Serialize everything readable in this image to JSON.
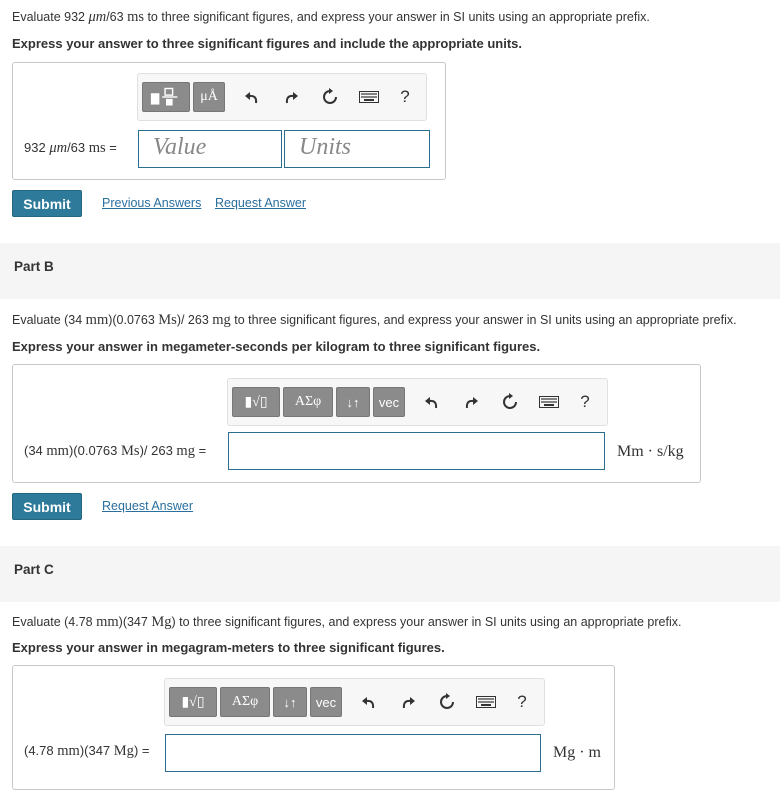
{
  "partA": {
    "prompt": {
      "pre": "Evaluate 932 ",
      "unit_um": "μm",
      "mid": "/63 ",
      "unit_ms": "ms",
      "post": " to three significant figures, and express your answer in SI units using an appropriate prefix."
    },
    "instruction": "Express your answer to three significant figures and include the appropriate units.",
    "toolbar": {
      "unit_button_label": "μÅ",
      "help_label": "?"
    },
    "label": {
      "pre": "932 ",
      "unit_um": "μm",
      "mid": "/63 ",
      "unit_ms": "ms",
      "post": " ="
    },
    "value_placeholder": "Value",
    "units_placeholder": "Units",
    "submit_label": "Submit",
    "previous_answers_label": "Previous Answers",
    "request_answer_label": "Request Answer"
  },
  "partB": {
    "header": "Part B",
    "prompt": {
      "p1": "Evaluate (34 ",
      "u1": "mm",
      "p2": ")(0.0763 ",
      "u2": "Ms",
      "p3": ")/ 263 ",
      "u3": "mg",
      "p4": " to three significant figures, and express your answer in SI units using an appropriate prefix."
    },
    "instruction": "Express your answer in megameter-seconds per kilogram to three significant figures.",
    "toolbar": {
      "template_label": "▮√▯",
      "greek_label": "ΑΣφ",
      "arrows_label": "↓↑",
      "vec_label": "vec",
      "help_label": "?"
    },
    "label": {
      "p1": "(34 ",
      "u1": "mm",
      "p2": ")(0.0763 ",
      "u2": "Ms",
      "p3": ")/ 263 ",
      "u3": "mg",
      "p4": " ="
    },
    "unit_after": "Mm · s/kg",
    "submit_label": "Submit",
    "request_answer_label": "Request Answer"
  },
  "partC": {
    "header": "Part C",
    "prompt": {
      "p1": "Evaluate (4.78 ",
      "u1": "mm",
      "p2": ")(347 ",
      "u2": "Mg",
      "p3": ") to three significant figures, and express your answer in SI units using an appropriate prefix."
    },
    "instruction": "Express your answer in megagram-meters to three significant figures.",
    "toolbar": {
      "template_label": "▮√▯",
      "greek_label": "ΑΣφ",
      "arrows_label": "↓↑",
      "vec_label": "vec",
      "help_label": "?"
    },
    "label": {
      "p1": "(4.78 ",
      "u1": "mm",
      "p2": ")(347 ",
      "u2": "Mg",
      "p3": ") ="
    },
    "unit_after": "Mg · m"
  },
  "colors": {
    "submit": "#2e7a9b",
    "link": "#2a6f9e",
    "field_border": "#2a6f8f",
    "toolbar_button": "#8b8b8b",
    "part_header_bg": "#f5f5f5"
  },
  "icons": [
    "fraction-template-icon",
    "undo-icon",
    "redo-icon",
    "reset-icon",
    "keyboard-icon"
  ]
}
